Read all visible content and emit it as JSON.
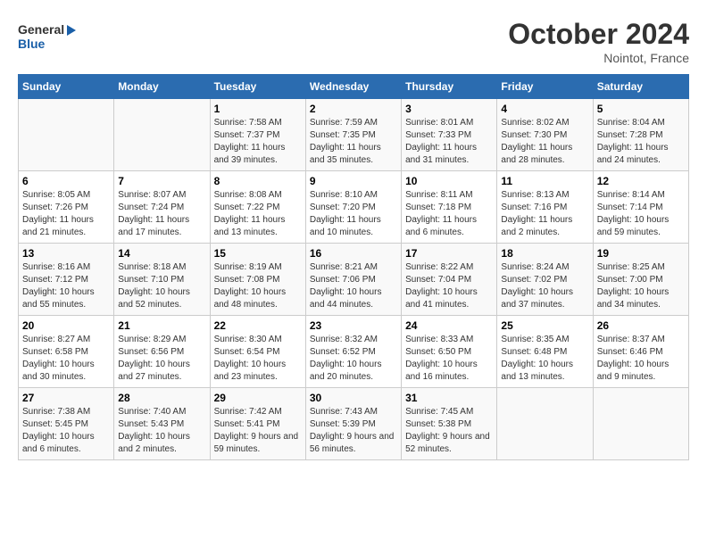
{
  "header": {
    "logo_general": "General",
    "logo_blue": "Blue",
    "month_year": "October 2024",
    "location": "Nointot, France"
  },
  "days_of_week": [
    "Sunday",
    "Monday",
    "Tuesday",
    "Wednesday",
    "Thursday",
    "Friday",
    "Saturday"
  ],
  "weeks": [
    [
      {
        "num": "",
        "empty": true
      },
      {
        "num": "",
        "empty": true
      },
      {
        "num": "1",
        "sunrise": "Sunrise: 7:58 AM",
        "sunset": "Sunset: 7:37 PM",
        "daylight": "Daylight: 11 hours and 39 minutes."
      },
      {
        "num": "2",
        "sunrise": "Sunrise: 7:59 AM",
        "sunset": "Sunset: 7:35 PM",
        "daylight": "Daylight: 11 hours and 35 minutes."
      },
      {
        "num": "3",
        "sunrise": "Sunrise: 8:01 AM",
        "sunset": "Sunset: 7:33 PM",
        "daylight": "Daylight: 11 hours and 31 minutes."
      },
      {
        "num": "4",
        "sunrise": "Sunrise: 8:02 AM",
        "sunset": "Sunset: 7:30 PM",
        "daylight": "Daylight: 11 hours and 28 minutes."
      },
      {
        "num": "5",
        "sunrise": "Sunrise: 8:04 AM",
        "sunset": "Sunset: 7:28 PM",
        "daylight": "Daylight: 11 hours and 24 minutes."
      }
    ],
    [
      {
        "num": "6",
        "sunrise": "Sunrise: 8:05 AM",
        "sunset": "Sunset: 7:26 PM",
        "daylight": "Daylight: 11 hours and 21 minutes."
      },
      {
        "num": "7",
        "sunrise": "Sunrise: 8:07 AM",
        "sunset": "Sunset: 7:24 PM",
        "daylight": "Daylight: 11 hours and 17 minutes."
      },
      {
        "num": "8",
        "sunrise": "Sunrise: 8:08 AM",
        "sunset": "Sunset: 7:22 PM",
        "daylight": "Daylight: 11 hours and 13 minutes."
      },
      {
        "num": "9",
        "sunrise": "Sunrise: 8:10 AM",
        "sunset": "Sunset: 7:20 PM",
        "daylight": "Daylight: 11 hours and 10 minutes."
      },
      {
        "num": "10",
        "sunrise": "Sunrise: 8:11 AM",
        "sunset": "Sunset: 7:18 PM",
        "daylight": "Daylight: 11 hours and 6 minutes."
      },
      {
        "num": "11",
        "sunrise": "Sunrise: 8:13 AM",
        "sunset": "Sunset: 7:16 PM",
        "daylight": "Daylight: 11 hours and 2 minutes."
      },
      {
        "num": "12",
        "sunrise": "Sunrise: 8:14 AM",
        "sunset": "Sunset: 7:14 PM",
        "daylight": "Daylight: 10 hours and 59 minutes."
      }
    ],
    [
      {
        "num": "13",
        "sunrise": "Sunrise: 8:16 AM",
        "sunset": "Sunset: 7:12 PM",
        "daylight": "Daylight: 10 hours and 55 minutes."
      },
      {
        "num": "14",
        "sunrise": "Sunrise: 8:18 AM",
        "sunset": "Sunset: 7:10 PM",
        "daylight": "Daylight: 10 hours and 52 minutes."
      },
      {
        "num": "15",
        "sunrise": "Sunrise: 8:19 AM",
        "sunset": "Sunset: 7:08 PM",
        "daylight": "Daylight: 10 hours and 48 minutes."
      },
      {
        "num": "16",
        "sunrise": "Sunrise: 8:21 AM",
        "sunset": "Sunset: 7:06 PM",
        "daylight": "Daylight: 10 hours and 44 minutes."
      },
      {
        "num": "17",
        "sunrise": "Sunrise: 8:22 AM",
        "sunset": "Sunset: 7:04 PM",
        "daylight": "Daylight: 10 hours and 41 minutes."
      },
      {
        "num": "18",
        "sunrise": "Sunrise: 8:24 AM",
        "sunset": "Sunset: 7:02 PM",
        "daylight": "Daylight: 10 hours and 37 minutes."
      },
      {
        "num": "19",
        "sunrise": "Sunrise: 8:25 AM",
        "sunset": "Sunset: 7:00 PM",
        "daylight": "Daylight: 10 hours and 34 minutes."
      }
    ],
    [
      {
        "num": "20",
        "sunrise": "Sunrise: 8:27 AM",
        "sunset": "Sunset: 6:58 PM",
        "daylight": "Daylight: 10 hours and 30 minutes."
      },
      {
        "num": "21",
        "sunrise": "Sunrise: 8:29 AM",
        "sunset": "Sunset: 6:56 PM",
        "daylight": "Daylight: 10 hours and 27 minutes."
      },
      {
        "num": "22",
        "sunrise": "Sunrise: 8:30 AM",
        "sunset": "Sunset: 6:54 PM",
        "daylight": "Daylight: 10 hours and 23 minutes."
      },
      {
        "num": "23",
        "sunrise": "Sunrise: 8:32 AM",
        "sunset": "Sunset: 6:52 PM",
        "daylight": "Daylight: 10 hours and 20 minutes."
      },
      {
        "num": "24",
        "sunrise": "Sunrise: 8:33 AM",
        "sunset": "Sunset: 6:50 PM",
        "daylight": "Daylight: 10 hours and 16 minutes."
      },
      {
        "num": "25",
        "sunrise": "Sunrise: 8:35 AM",
        "sunset": "Sunset: 6:48 PM",
        "daylight": "Daylight: 10 hours and 13 minutes."
      },
      {
        "num": "26",
        "sunrise": "Sunrise: 8:37 AM",
        "sunset": "Sunset: 6:46 PM",
        "daylight": "Daylight: 10 hours and 9 minutes."
      }
    ],
    [
      {
        "num": "27",
        "sunrise": "Sunrise: 7:38 AM",
        "sunset": "Sunset: 5:45 PM",
        "daylight": "Daylight: 10 hours and 6 minutes."
      },
      {
        "num": "28",
        "sunrise": "Sunrise: 7:40 AM",
        "sunset": "Sunset: 5:43 PM",
        "daylight": "Daylight: 10 hours and 2 minutes."
      },
      {
        "num": "29",
        "sunrise": "Sunrise: 7:42 AM",
        "sunset": "Sunset: 5:41 PM",
        "daylight": "Daylight: 9 hours and 59 minutes."
      },
      {
        "num": "30",
        "sunrise": "Sunrise: 7:43 AM",
        "sunset": "Sunset: 5:39 PM",
        "daylight": "Daylight: 9 hours and 56 minutes."
      },
      {
        "num": "31",
        "sunrise": "Sunrise: 7:45 AM",
        "sunset": "Sunset: 5:38 PM",
        "daylight": "Daylight: 9 hours and 52 minutes."
      },
      {
        "num": "",
        "empty": true
      },
      {
        "num": "",
        "empty": true
      }
    ]
  ]
}
